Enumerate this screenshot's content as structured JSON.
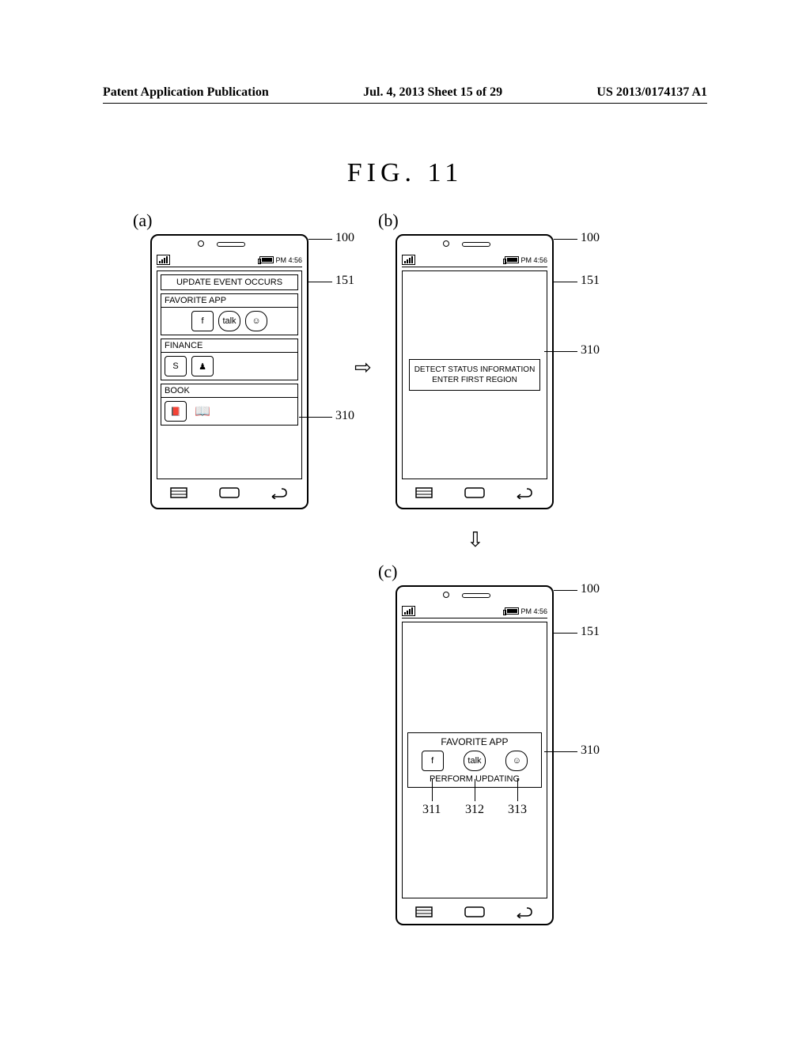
{
  "header": {
    "left": "Patent Application Publication",
    "center": "Jul. 4, 2013  Sheet 15 of 29",
    "right": "US 2013/0174137 A1"
  },
  "figure_title": "FIG.  11",
  "sublabels": {
    "a": "(a)",
    "b": "(b)",
    "c": "(c)"
  },
  "status_bar_time": "PM 4:56",
  "phone_a": {
    "banner": "UPDATE EVENT OCCURS",
    "sections": {
      "favorite": {
        "title": "FAVORITE APP",
        "icons": [
          "f",
          "talk",
          "☺"
        ]
      },
      "finance": {
        "title": "FINANCE",
        "icons": [
          "S",
          "♟"
        ]
      },
      "book": {
        "title": "BOOK",
        "icons": [
          "📕",
          "📖"
        ]
      }
    }
  },
  "phone_b": {
    "message_line1": "DETECT STATUS INFORMATION",
    "message_line2": "ENTER FIRST REGION"
  },
  "phone_c": {
    "title": "FAVORITE APP",
    "icons": [
      "f",
      "talk",
      "☺"
    ],
    "caption": "PERFORM UPDATING",
    "icon_refs": [
      "311",
      "312",
      "313"
    ]
  },
  "refs": {
    "r100": "100",
    "r151": "151",
    "r310": "310"
  }
}
